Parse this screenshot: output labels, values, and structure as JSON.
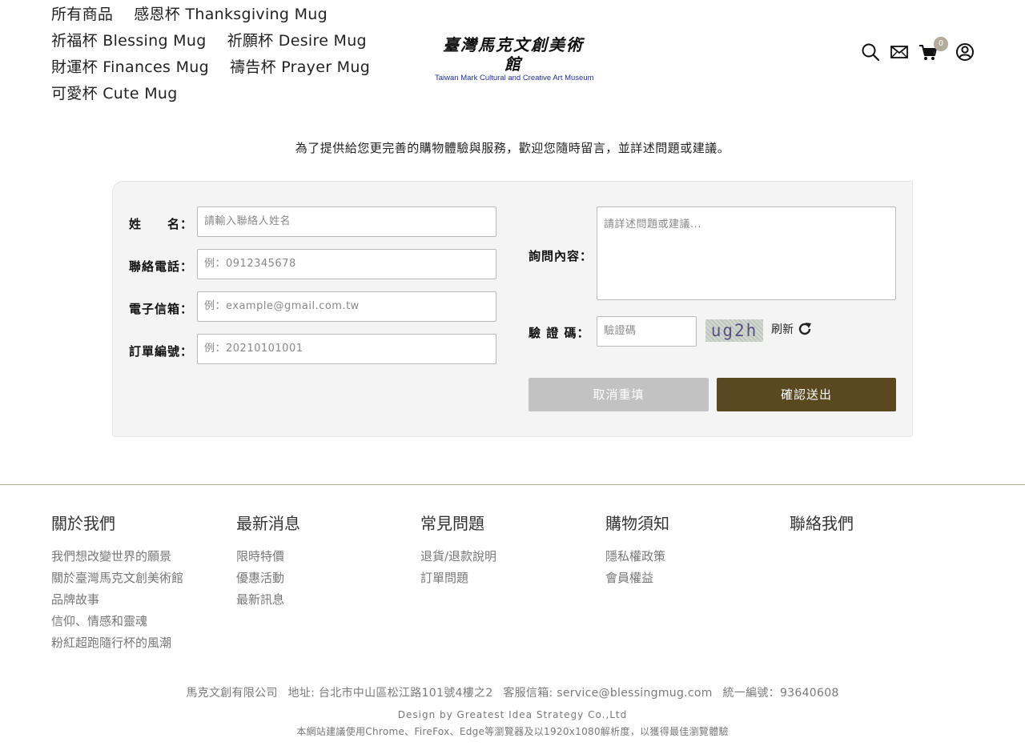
{
  "nav": {
    "rows": [
      [
        "所有商品",
        "感恩杯 Thanksgiving Mug"
      ],
      [
        "祈福杯 Blessing Mug",
        "祈願杯 Desire Mug"
      ],
      [
        "財運杯 Finances Mug",
        "禱告杯 Prayer Mug"
      ],
      [
        "可愛杯 Cute Mug"
      ]
    ]
  },
  "logo": {
    "cn": "臺灣馬克文創美術館",
    "en": "Taiwan Mark Cultural and Creative Art Museum"
  },
  "header_icons": {
    "search": "search-icon",
    "mail": "mail-icon",
    "cart": "cart-icon",
    "cart_count": "0",
    "user": "user-icon"
  },
  "intro": "為了提供給您更完善的購物體驗與服務，歡迎您隨時留言，並詳述問題或建議。",
  "form": {
    "name": {
      "label": "姓　　名：",
      "placeholder": "請輸入聯絡人姓名"
    },
    "phone": {
      "label": "聯絡電話：",
      "placeholder": "例：0912345678"
    },
    "email": {
      "label": "電子信箱：",
      "placeholder": "例：example@gmail.com.tw"
    },
    "order": {
      "label": "訂單編號：",
      "placeholder": "例：20210101001"
    },
    "inquiry": {
      "label": "詢問內容：",
      "placeholder": "請詳述問題或建議..."
    },
    "captcha": {
      "label": "驗 證 碼：",
      "placeholder": "驗證碼",
      "code": "ug2h",
      "refresh": "刷新"
    },
    "reset_label": "取消重填",
    "submit_label": "確認送出"
  },
  "colors": {
    "submit": "#5a4820",
    "reset": "#c2c2c2",
    "badge": "#b3ab9b",
    "footer_line": "#b0ac98"
  },
  "footer": {
    "columns": [
      {
        "title": "關於我們",
        "links": [
          "我們想改變世界的願景",
          "關於臺灣馬克文創美術館",
          "品牌故事",
          "信仰、情感和靈魂",
          "粉紅超跑隨行杯的風潮"
        ]
      },
      {
        "title": "最新消息",
        "links": [
          "限時特價",
          "優惠活動",
          "最新訊息"
        ]
      },
      {
        "title": "常見問題",
        "links": [
          "退貨/退款說明",
          "訂單問題"
        ]
      },
      {
        "title": "購物須知",
        "links": [
          "隱私權政策",
          "會員權益"
        ]
      },
      {
        "title": "聯絡我們",
        "links": []
      }
    ],
    "company": "馬克文創有限公司",
    "address": "地址: 台北市中山區松江路101號4樓之2",
    "service_email": "客服信箱: service@blessingmug.com",
    "tax_id": "統一編號：93640608",
    "design": "Design by Greatest Idea Strategy Co.,Ltd",
    "browser_note": "本網站建議使用Chrome、FireFox、Edge等瀏覽器及以1920x1080解析度，以獲得最佳瀏覽體驗"
  }
}
